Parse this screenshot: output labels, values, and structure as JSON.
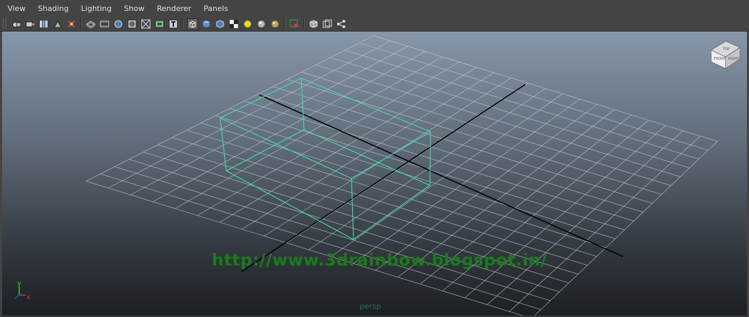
{
  "menu": {
    "items": [
      {
        "label": "View"
      },
      {
        "label": "Shading"
      },
      {
        "label": "Lighting"
      },
      {
        "label": "Show"
      },
      {
        "label": "Renderer"
      },
      {
        "label": "Panels"
      }
    ]
  },
  "toolbar": {
    "groups": [
      [
        "select-camera-icon",
        "lock-camera-icon",
        "camera-attributes-icon",
        "bookmark-icon",
        "image-plane-icon"
      ],
      [
        "grid-icon",
        "film-gate-icon",
        "resolution-gate-icon",
        "gate-mask-icon",
        "field-chart-icon",
        "safe-action-icon",
        "safe-title-icon"
      ],
      [
        "wireframe-icon",
        "smooth-shade-icon",
        "shade-selected-icon",
        "textured-icon",
        "default-lighting-icon",
        "all-lights-icon",
        "shadows-icon"
      ],
      [
        "isolate-select-icon"
      ],
      [
        "xray-icon",
        "xray-active-icon",
        "xray-joints-icon"
      ]
    ],
    "pressed": [
      "wireframe-icon"
    ]
  },
  "viewport": {
    "watermark": "http://www.3drainbow.blogspot.in/",
    "camera_label": "persp",
    "view_cube_faces": {
      "top": "TOP",
      "front": "FRONT",
      "right": "RIGHT"
    },
    "axis_labels": {
      "x": "x",
      "y": "y"
    },
    "colors": {
      "grid": "#c8d0d8",
      "axis": "#000000",
      "wireframe": "#45e0a8",
      "watermark": "#1c7a1c",
      "axis_x": "#e03030",
      "axis_y": "#30d030",
      "axis_z": "#3050e0"
    }
  }
}
